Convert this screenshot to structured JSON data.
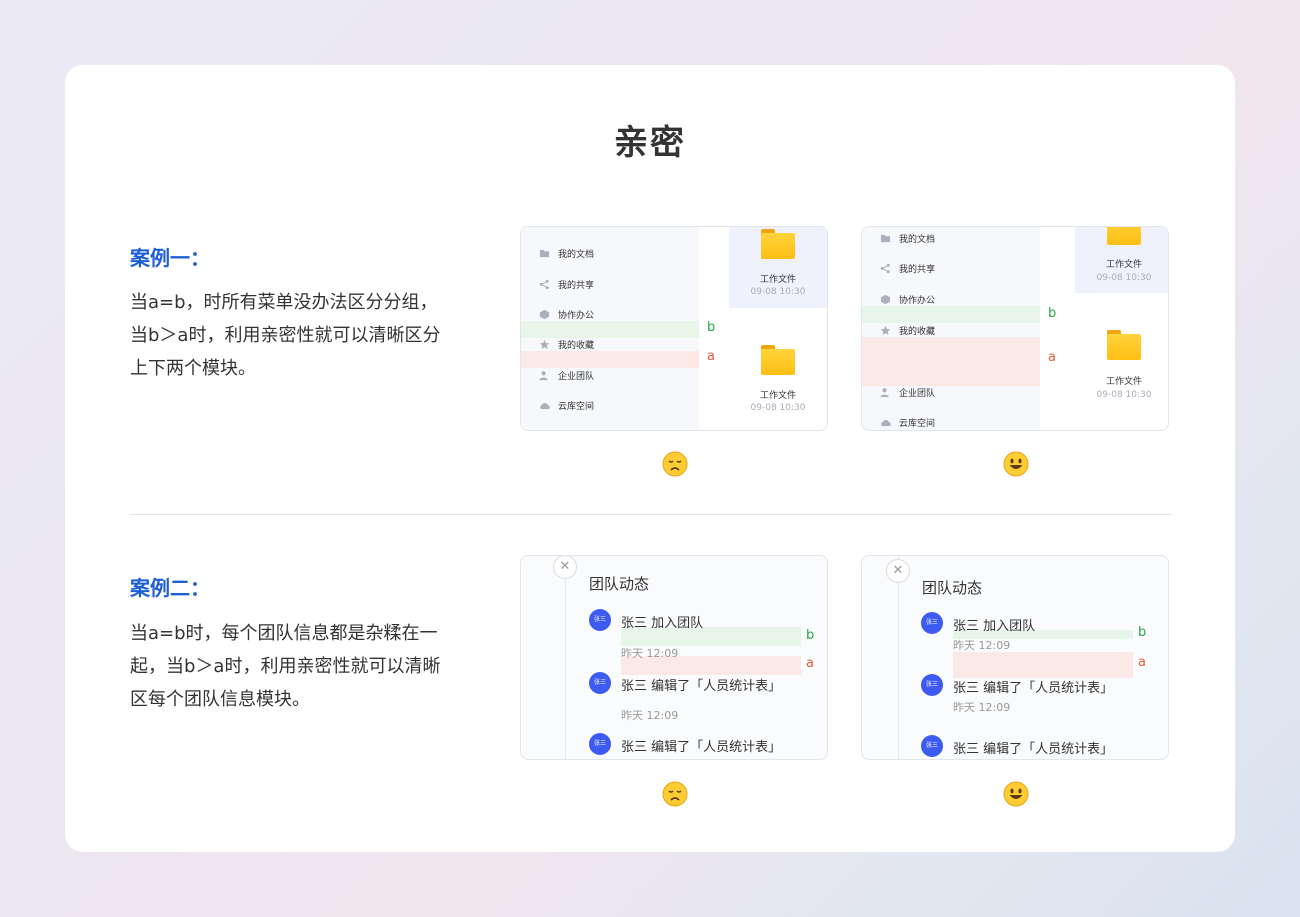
{
  "page": {
    "title": "亲密"
  },
  "case1": {
    "title": "案例一：",
    "desc": "当a=b，时所有菜单没办法区分分组，当b＞a时，利用亲密性就可以清晰区分上下两个模块。"
  },
  "case2": {
    "title": "案例二：",
    "desc": "当a=b时，每个团队信息都是杂糅在一起，当b＞a时，利用亲密性就可以清晰区每个团队信息模块。"
  },
  "labels": {
    "a": "a",
    "b": "b"
  },
  "file_panel": {
    "menu": [
      {
        "label": "我的文档",
        "icon": "folder-icon"
      },
      {
        "label": "我的共享",
        "icon": "share-icon"
      },
      {
        "label": "协作办公",
        "icon": "cube-icon"
      },
      {
        "label": "我的收藏",
        "icon": "star-icon"
      },
      {
        "label": "企业团队",
        "icon": "team-icon"
      },
      {
        "label": "云库空间",
        "icon": "cloud-icon"
      }
    ],
    "files": [
      {
        "name": "工作文件",
        "date": "09-08 10:30"
      },
      {
        "name": "工作文件",
        "date": "09-08 10:30"
      }
    ]
  },
  "team_panel": {
    "heading": "团队动态",
    "avatar_text": "张三",
    "items": [
      {
        "text": "张三 加入团队",
        "time": "昨天 12:09"
      },
      {
        "text": "张三 编辑了「人员统计表」",
        "time": "昨天 12:09"
      },
      {
        "text": "张三 编辑了「人员统计表」"
      }
    ]
  },
  "ratings": {
    "bad": "sad-face-icon",
    "good": "happy-face-icon"
  },
  "colors": {
    "accent": "#1f5fd6",
    "green_label": "#2aa745",
    "red_label": "#e85a3a",
    "avatar": "#3d5bf0",
    "folder": "#ffc51e"
  }
}
